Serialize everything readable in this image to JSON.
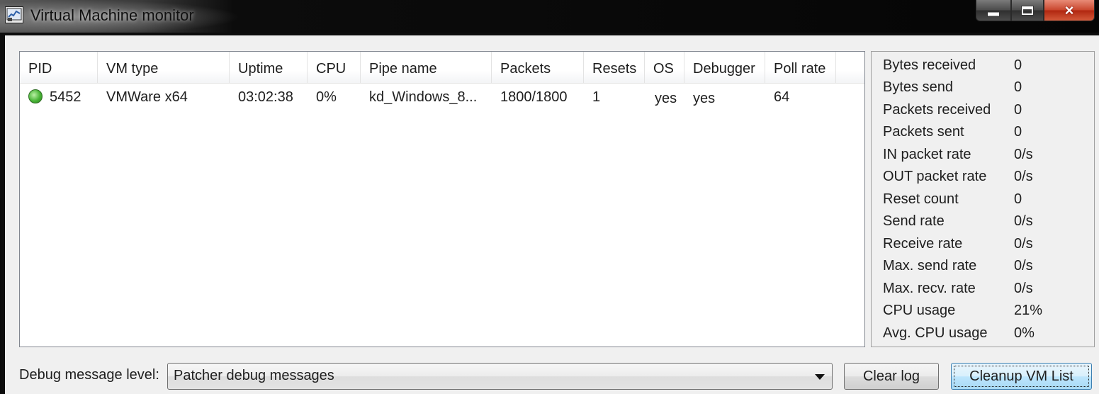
{
  "window": {
    "title": "Virtual Machine monitor",
    "caption_buttons": {
      "minimize": "minimize-icon",
      "maximize": "maximize-icon",
      "close": "×"
    }
  },
  "vm_list": {
    "columns": [
      "PID",
      "VM type",
      "Uptime",
      "CPU",
      "Pipe name",
      "Packets",
      "Resets",
      "OS",
      "Debugger",
      "Poll rate"
    ],
    "rows": [
      {
        "status_color": "#48b436",
        "pid": "5452",
        "vm_type": "VMWare x64",
        "uptime": "03:02:38",
        "cpu": "0%",
        "pipe_name": "kd_Windows_8...",
        "packets": "1800/1800",
        "resets": "1",
        "os": "yes",
        "debugger": "yes",
        "poll_rate": "64"
      }
    ]
  },
  "stats": [
    {
      "label": "Bytes received",
      "value": "0"
    },
    {
      "label": "Bytes send",
      "value": "0"
    },
    {
      "label": "Packets received",
      "value": "0"
    },
    {
      "label": "Packets sent",
      "value": "0"
    },
    {
      "label": "IN packet rate",
      "value": "0/s"
    },
    {
      "label": "OUT packet rate",
      "value": "0/s"
    },
    {
      "label": "Reset count",
      "value": "0"
    },
    {
      "label": "Send rate",
      "value": "0/s"
    },
    {
      "label": "Receive rate",
      "value": "0/s"
    },
    {
      "label": "Max. send rate",
      "value": "0/s"
    },
    {
      "label": "Max. recv. rate",
      "value": "0/s"
    },
    {
      "label": "CPU usage",
      "value": "21%"
    },
    {
      "label": "Avg. CPU usage",
      "value": "0%"
    }
  ],
  "bottom": {
    "debug_label": "Debug message level:",
    "debug_level": "Patcher debug messages",
    "clear_log": "Clear log",
    "cleanup": "Cleanup VM List"
  }
}
